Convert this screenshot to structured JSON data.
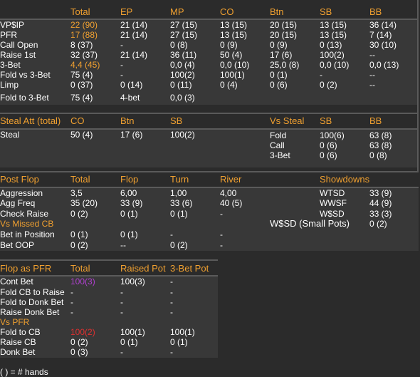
{
  "preflop": {
    "headers": [
      "Total",
      "EP",
      "MP",
      "CO",
      "Btn",
      "SB",
      "BB"
    ],
    "rows": [
      {
        "label": "VP$IP",
        "cells": [
          "22 (90)",
          "21 (14)",
          "27 (15)",
          "13 (15)",
          "20 (15)",
          "13 (15)",
          "36 (14)"
        ]
      },
      {
        "label": "PFR",
        "cells": [
          "17 (88)",
          "21 (14)",
          "27 (15)",
          "13 (15)",
          "20 (15)",
          "13 (15)",
          "7 (14)"
        ]
      },
      {
        "label": "Call Open",
        "cells": [
          "8 (37)",
          "-",
          "0 (8)",
          "0 (9)",
          "0 (9)",
          "0 (13)",
          "30 (10)"
        ]
      },
      {
        "label": "Raise 1st",
        "cells": [
          "32 (37)",
          "21 (14)",
          "36 (11)",
          "50 (4)",
          "17 (6)",
          "100(2)",
          "--"
        ]
      },
      {
        "label": "3-Bet",
        "cells": [
          "4,4 (45)",
          "-",
          "0,0 (4)",
          "0,0 (10)",
          "25,0 (8)",
          "0,0 (10)",
          "0,0 (13)"
        ]
      },
      {
        "label": "Fold vs 3-Bet",
        "cells": [
          "75 (4)",
          "-",
          "100(2)",
          "100(1)",
          "0 (1)",
          "-",
          "--"
        ]
      },
      {
        "label": "Limp",
        "cells": [
          "0 (37)",
          "0 (14)",
          "0 (11)",
          "0 (4)",
          "0 (6)",
          "0 (2)",
          "--"
        ]
      },
      {
        "label": "Fold to 3-Bet",
        "cells": [
          "75 (4)",
          "4-bet",
          "0,0 (3)",
          "",
          "",
          "",
          ""
        ]
      }
    ]
  },
  "steal": {
    "title": "Steal Att (total)",
    "headers": [
      "CO",
      "Btn",
      "SB"
    ],
    "row_label": "Steal",
    "row_cells": [
      "50 (4)",
      "17 (6)",
      "100(2)"
    ],
    "vs_title": "Vs Steal",
    "vs_headers": [
      "SB",
      "BB"
    ],
    "vs_rows": [
      {
        "label": "Fold",
        "cells": [
          "100(6)",
          "63 (8)"
        ]
      },
      {
        "label": "Call",
        "cells": [
          "0 (6)",
          "63 (8)"
        ]
      },
      {
        "label": "3-Bet",
        "cells": [
          "0 (6)",
          "0 (8)"
        ]
      }
    ]
  },
  "postflop": {
    "title": "Post Flop",
    "headers": [
      "Total",
      "Flop",
      "Turn",
      "River"
    ],
    "rows": [
      {
        "label": "Aggression",
        "cells": [
          "3,5",
          "6,00",
          "1,00",
          "4,00"
        ]
      },
      {
        "label": "Agg Freq",
        "cells": [
          "35 (20)",
          "33 (9)",
          "33 (6)",
          "40 (5)"
        ]
      },
      {
        "label": "Check Raise",
        "cells": [
          "0 (2)",
          "0 (1)",
          "0 (1)",
          "-"
        ]
      }
    ],
    "vs_missed_title": "Vs Missed CB",
    "vs_missed_rows": [
      {
        "label": "Bet in Position",
        "cells": [
          "0 (1)",
          "0 (1)",
          "-",
          "-"
        ]
      },
      {
        "label": "Bet OOP",
        "cells": [
          "0 (2)",
          "--",
          "0 (2)",
          "-"
        ]
      }
    ],
    "showdowns_title": "Showdowns",
    "showdowns": [
      {
        "label": "WTSD",
        "value": "33 (9)"
      },
      {
        "label": "WWSF",
        "value": "44 (9)"
      },
      {
        "label": "W$SD",
        "value": "33 (3)"
      },
      {
        "label": "W$SD (Small Pots)",
        "value": "0 (2)"
      }
    ]
  },
  "flop_pfr": {
    "title": "Flop as PFR",
    "headers": [
      "Total",
      "Raised Pot",
      "3-Bet Pot"
    ],
    "rows": [
      {
        "label": "Cont Bet",
        "cells": [
          "100(3)",
          "100(3)",
          "-"
        ]
      },
      {
        "label": "Fold CB to Raise",
        "cells": [
          "-",
          "-",
          "-"
        ]
      },
      {
        "label": "Fold to Donk Bet",
        "cells": [
          "-",
          "-",
          "-"
        ]
      },
      {
        "label": "Raise Donk Bet",
        "cells": [
          "-",
          "-",
          "-"
        ]
      }
    ],
    "vs_title": "Vs PFR",
    "vs_rows": [
      {
        "label": "Fold to CB",
        "cells": [
          "100(2)",
          "100(1)",
          "100(1)"
        ]
      },
      {
        "label": "Raise CB",
        "cells": [
          "0 (2)",
          "0 (1)",
          "0 (1)"
        ]
      },
      {
        "label": "Donk Bet",
        "cells": [
          "0 (3)",
          "-",
          "-"
        ]
      }
    ]
  },
  "footer": "( ) = # hands",
  "colors": {
    "header": "#f0a030",
    "background": "#2b2b2b",
    "highlight_purple": "#b040d0",
    "highlight_red": "#e03030"
  }
}
